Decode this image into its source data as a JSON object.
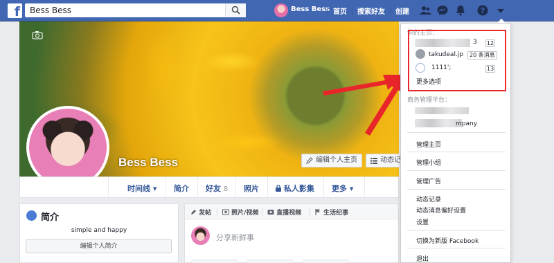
{
  "topbar": {
    "search_value": "Bess Bess",
    "profile_name": "Bess Bess",
    "nav": [
      "首页",
      "搜索好友",
      "创建"
    ]
  },
  "cover": {
    "name": "Bess Bess",
    "edit_profile": "编辑个人主页",
    "activity_log": "动态记"
  },
  "tabs": [
    "时间线 ▾",
    "简介",
    "好友",
    "照片",
    "私人影集",
    "更多 ▾"
  ],
  "friend_count": "8",
  "intro": {
    "title": "简介",
    "bio": "simple and happy",
    "edit_bio": "编辑个人简介"
  },
  "composer": {
    "items": [
      "发帖",
      "照片/视频",
      "直播视频",
      "生活纪事"
    ],
    "placeholder": "分享新鲜事"
  },
  "dropdown": {
    "your_pages": "你的主页：",
    "page1_suffix": "3",
    "page1_count": "12",
    "page2_name": "takudeal.jp",
    "page2_badge": "20 条消息",
    "page3_name": "1111';",
    "page3_count": "13",
    "more_options": "更多选项",
    "business_manager": "商务管理平台：",
    "business_suffix": "mpany",
    "manage_pages": "管理主页",
    "manage_groups": "管理小组",
    "manage_ads": "管理广告",
    "activity_log": "动态记录",
    "news_feed_prefs": "动态消息偏好设置",
    "settings": "设置",
    "switch_new": "切换为新版 Facebook",
    "logout": "退出"
  },
  "colors": {
    "brand_blue": "#4267b2",
    "annotation_red": "#e8262a"
  }
}
